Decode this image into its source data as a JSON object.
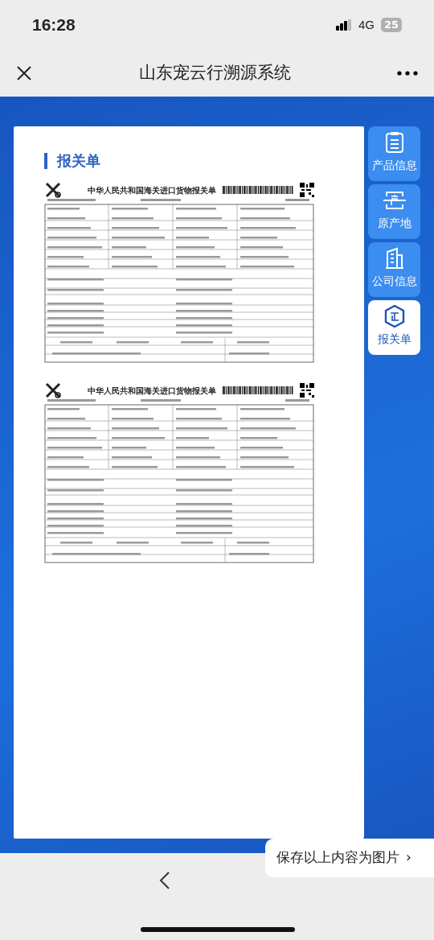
{
  "status_bar": {
    "time": "16:28",
    "network": "4G",
    "battery": "25"
  },
  "nav": {
    "title": "山东宠云行溯源系统"
  },
  "section_title": "报关单",
  "documents": [
    {
      "title": "中华人民共和国海关进口货物报关单"
    },
    {
      "title": "中华人民共和国海关进口货物报关单"
    }
  ],
  "side_tabs": [
    {
      "label": "产品信息",
      "selected": false
    },
    {
      "label": "原产地",
      "selected": false
    },
    {
      "label": "公司信息",
      "selected": false
    },
    {
      "label": "报关单",
      "selected": true
    }
  ],
  "save_popup": {
    "label": "保存以上内容为图片",
    "chevron": "›"
  }
}
